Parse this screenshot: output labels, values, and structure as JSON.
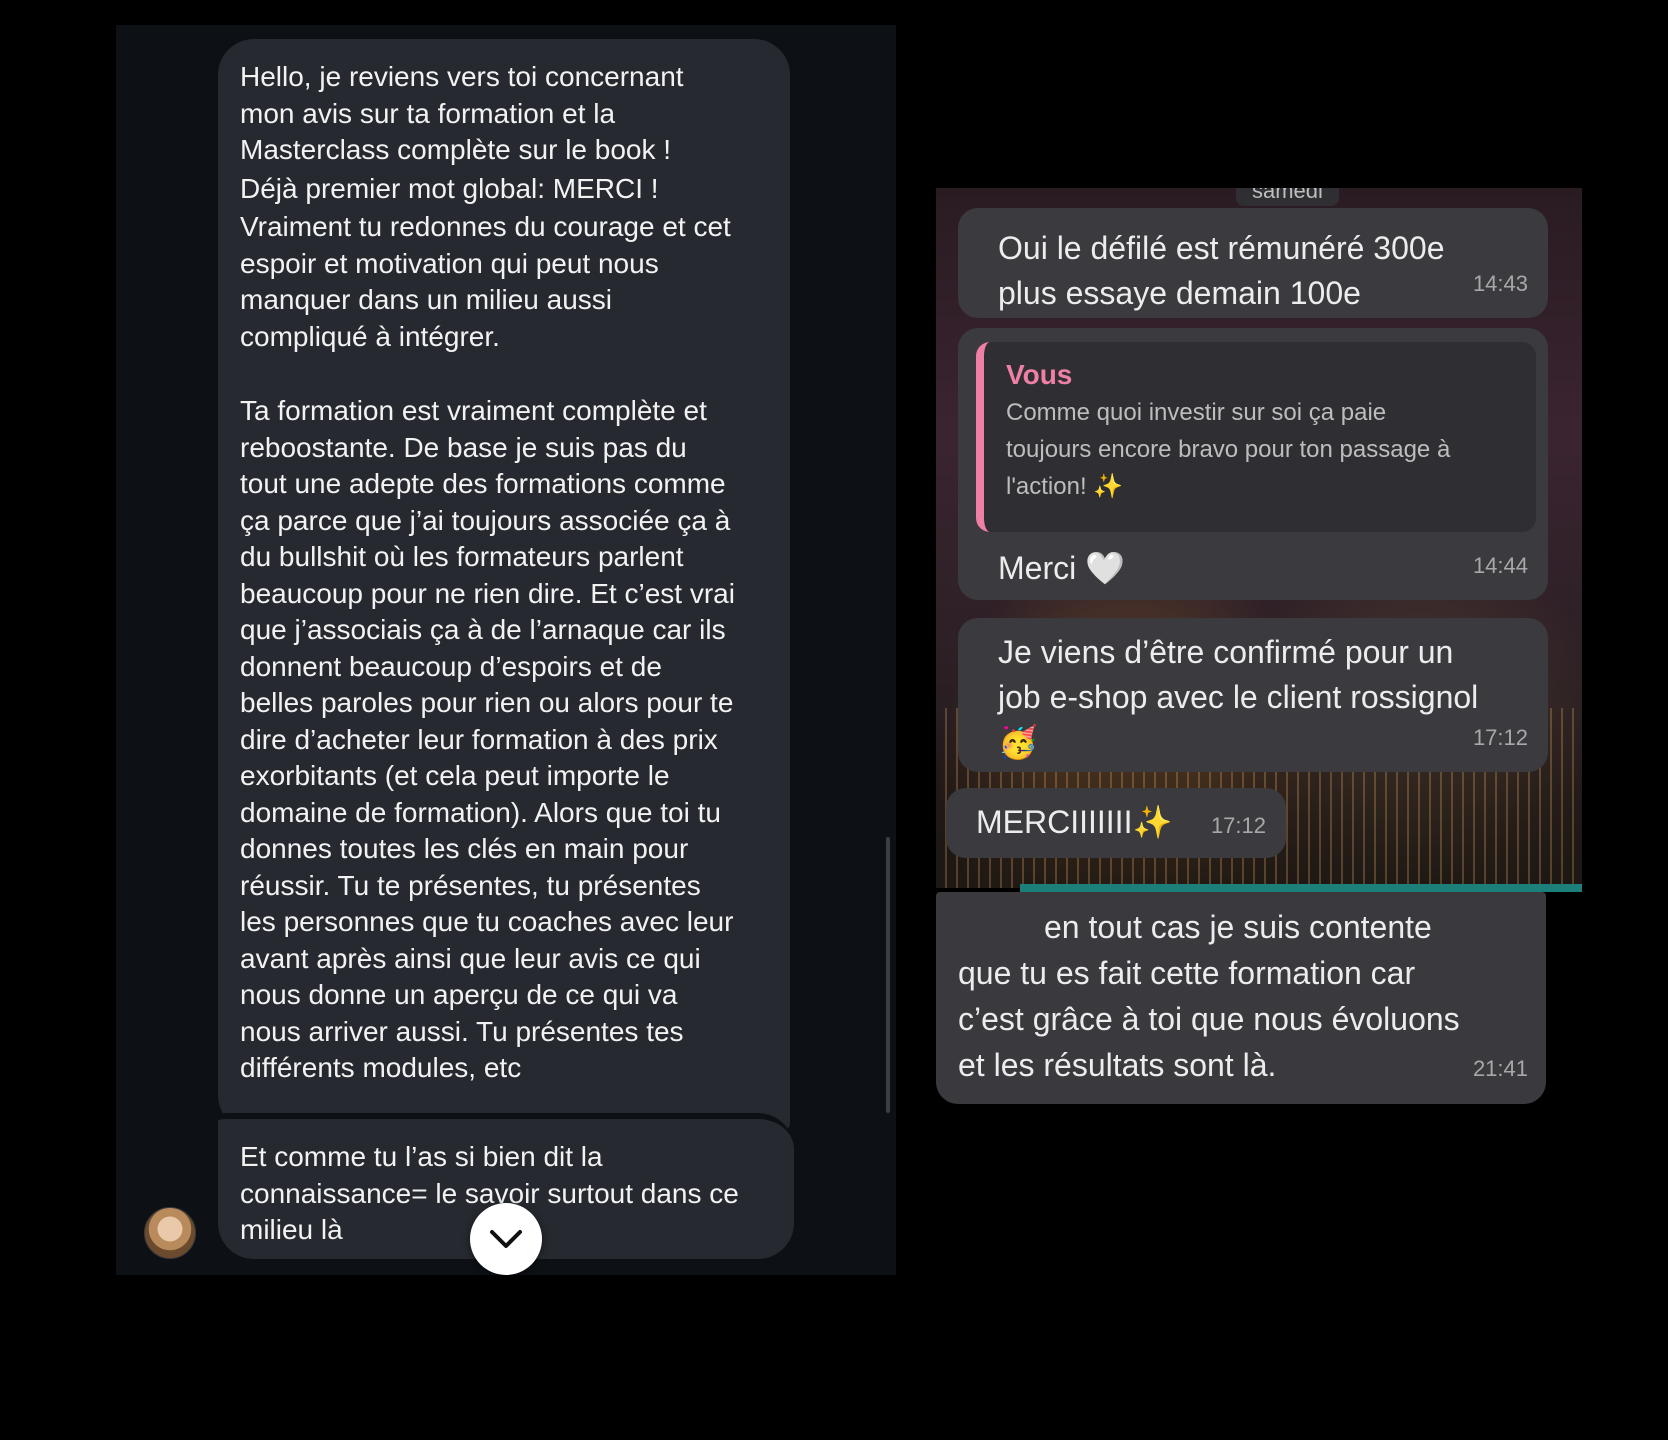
{
  "left_chat": {
    "message_1": {
      "para_1": "Hello, je reviens vers toi concernant\nmon avis sur ta formation et la\nMasterclass complète sur le book !",
      "para_2": "Déjà premier mot global: MERCI !",
      "para_3": "Vraiment tu redonnes du courage et cet\nespoir et motivation qui peut nous\nmanquer dans un milieu aussi\ncompliqué à intégrer.",
      "para_4": "Ta formation est vraiment complète et\nreboostante. De base je suis pas du\ntout une adepte des formations comme\nça parce que j’ai toujours associée ça à\ndu bullshit où les formateurs parlent\nbeaucoup pour ne rien dire. Et c’est vrai\nque j’associais ça à de l’arnaque car ils\ndonnent beaucoup d’espoirs et de\nbelles paroles pour rien ou alors pour te\ndire d’acheter leur formation à des prix\nexorbitants (et cela peut importe le\ndomaine de formation). Alors que toi tu\ndonnes toutes les clés en main pour\nréussir. Tu te présentes, tu présentes\nles personnes que tu coaches avec leur\navant après ainsi que leur avis ce qui\nnous donne un aperçu de ce qui va\nnous arriver aussi. Tu présentes tes\ndifférents modules, etc"
    },
    "message_2": "Et comme tu l’as si bien dit la\nconnaissance= le savoir surtout dans ce\nmilieu là",
    "icons": {
      "avatar": "avatar",
      "scroll_down": "chevron-down-icon"
    }
  },
  "right_chat": {
    "day_label": "samedi",
    "messages": [
      {
        "text": "Oui le défilé est rémunéré 300e\nplus essaye demain 100e",
        "time": "14:43"
      },
      {
        "quote_author": "Vous",
        "quote_text": "Comme quoi investir sur soi ça paie\ntoujours encore bravo pour ton passage à\nl'action! ✨",
        "text": "Merci 🤍",
        "time": "14:44"
      },
      {
        "text": "Je viens d’être confirmé pour un\njob e-shop avec le client rossignol\n🥳",
        "time": "17:12"
      },
      {
        "text": "MERCIIIIIII✨",
        "time": "17:12"
      }
    ],
    "bottom_message": {
      "line_1": "en tout cas je suis contente",
      "rest": "que tu es fait cette formation car\nc’est grâce à toi que nous évoluons\net les résultats sont là.",
      "time": "21:41"
    },
    "colors": {
      "quote_accent": "#f07fa6",
      "divider": "#1c7f7a"
    }
  }
}
